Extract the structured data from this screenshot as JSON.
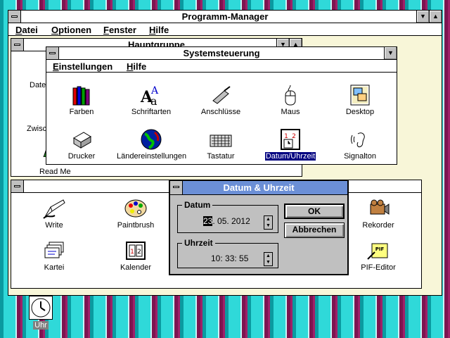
{
  "program_manager": {
    "title": "Programm-Manager",
    "menu": [
      "Datei",
      "Optionen",
      "Fenster",
      "Hilfe"
    ]
  },
  "hauptgruppe": {
    "title": "Hauptgruppe",
    "items": [
      "Datei",
      "Zwisc",
      "Read Me"
    ]
  },
  "zubehoer": {
    "items": [
      "Write",
      "Paintbrush",
      "Rekorder",
      "Kartei",
      "Kalender",
      "PIF-Editor"
    ]
  },
  "systemsteuerung": {
    "title": "Systemsteuerung",
    "menu": [
      "Einstellungen",
      "Hilfe"
    ],
    "items": [
      "Farben",
      "Schriftarten",
      "Anschlüsse",
      "Maus",
      "Desktop",
      "Drucker",
      "Ländereinstellungen",
      "Tastatur",
      "Datum/Uhrzeit",
      "Signalton"
    ],
    "selected": "Datum/Uhrzeit"
  },
  "dialog": {
    "title": "Datum & Uhrzeit",
    "datum_label": "Datum",
    "datum_value_first": "23",
    "datum_value_rest": ". 05. 2012",
    "uhrzeit_label": "Uhrzeit",
    "uhrzeit_value": "10: 33: 55",
    "ok": "OK",
    "cancel": "Abbrechen"
  },
  "desktop": {
    "clock_label": "Uhr"
  },
  "colors": {
    "active_title": "#6b8fd6",
    "selection": "#000080",
    "desktop_teal": "#2fd9d9",
    "desktop_magenta": "#a02068"
  }
}
